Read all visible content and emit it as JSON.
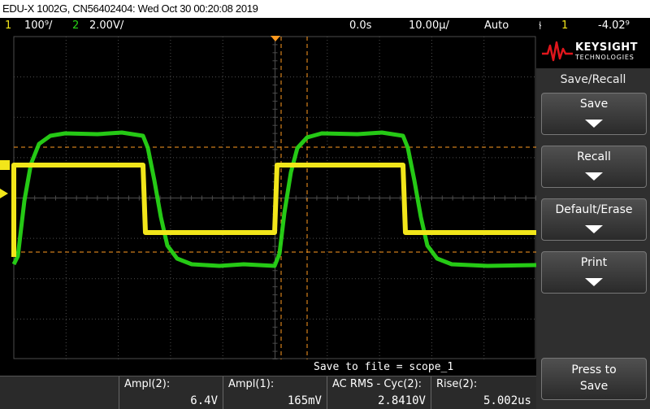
{
  "title": "EDU-X 1002G, CN56402404: Wed Oct 30 00:20:08 2019",
  "status": {
    "ch1_num": "1",
    "ch1_scale": "100⁹/",
    "ch2_num": "2",
    "ch2_scale": "2.00V/",
    "delay": "0.0s",
    "timebase": "10.00µ/",
    "mode": "Auto",
    "trigger_icon": "trigger-edge-icon",
    "trigger_source": "1",
    "trigger_level": "-4.02⁹"
  },
  "colors": {
    "ch1": "#f2e61a",
    "ch2": "#27d416",
    "marker": "#ff9a1f",
    "grid": "#4d4d4d"
  },
  "save_status": "Save to file = scope_1",
  "measurements": [
    {
      "label": "Ampl(2):",
      "value": "6.4V"
    },
    {
      "label": "Ampl(1):",
      "value": "165mV"
    },
    {
      "label": "AC RMS - Cyc(2):",
      "value": "2.8410V"
    },
    {
      "label": "Rise(2):",
      "value": "5.002us"
    }
  ],
  "side": {
    "brand": "KEYSIGHT",
    "brand_sub": "TECHNOLOGIES",
    "menu_title": "Save/Recall",
    "keys": [
      "Save",
      "Recall",
      "Default/Erase",
      "Print"
    ],
    "press_line1": "Press to",
    "press_line2": "Save"
  }
}
